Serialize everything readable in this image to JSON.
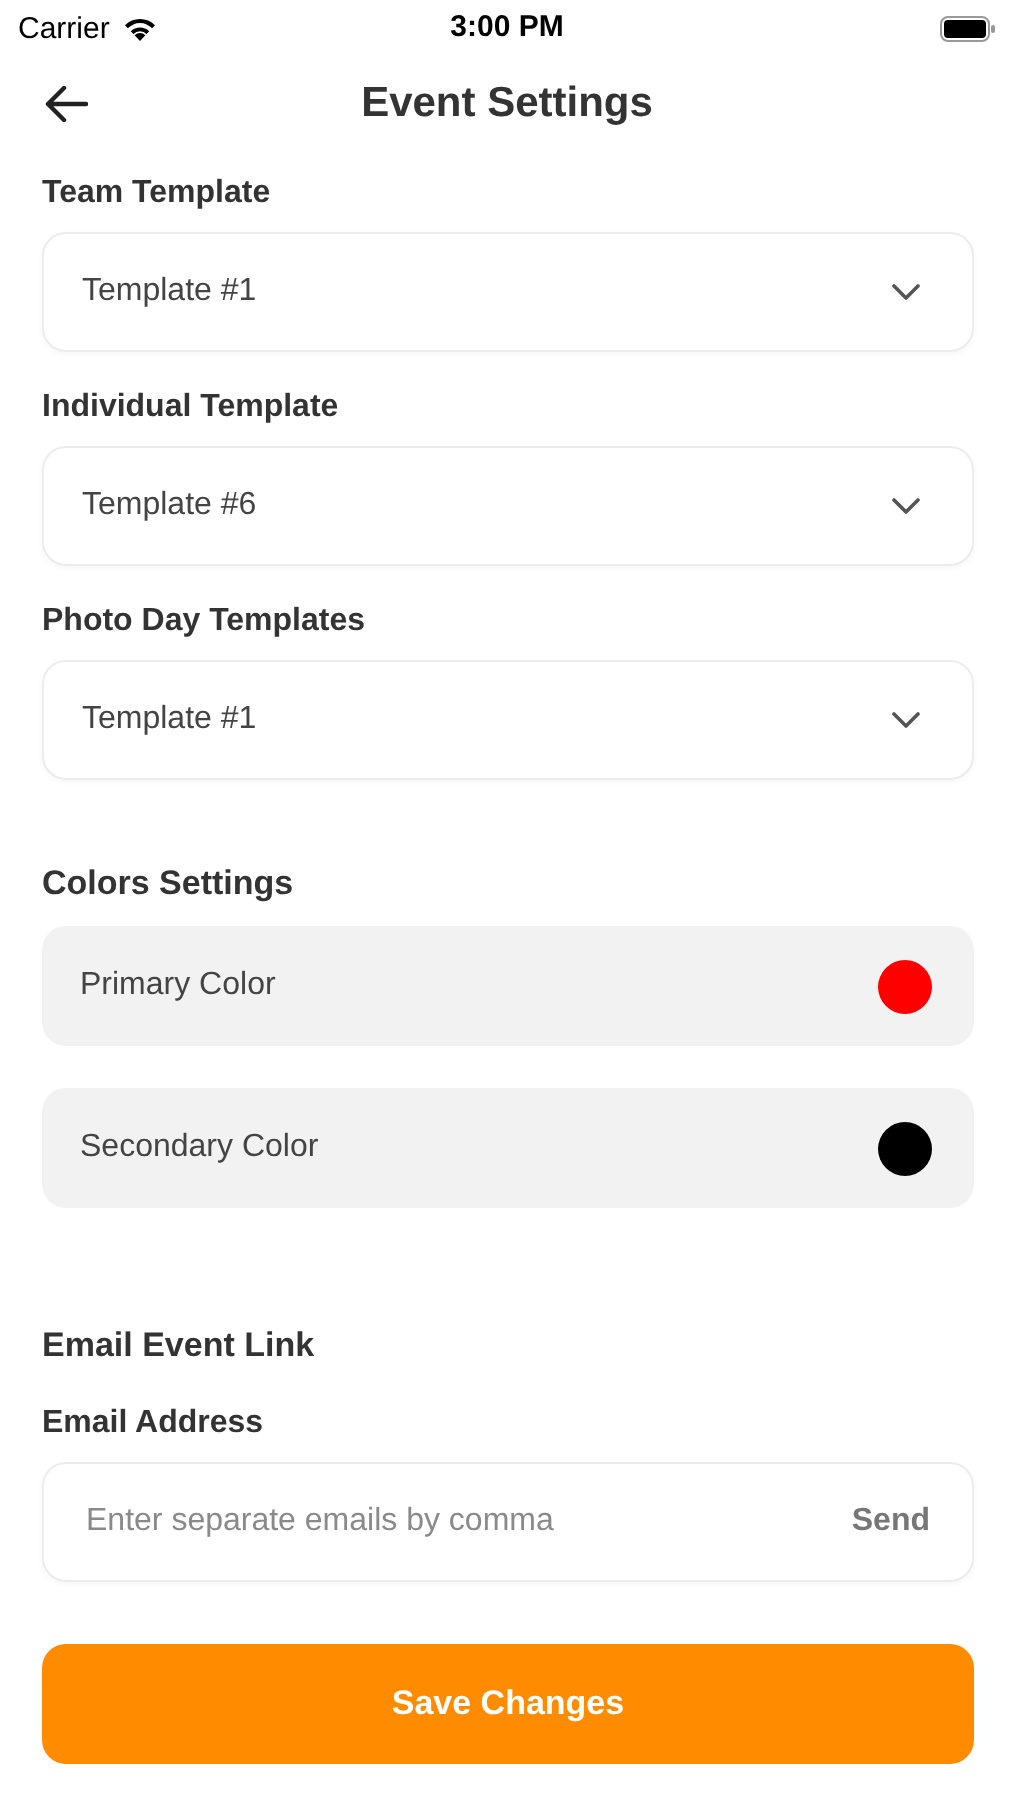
{
  "status_bar": {
    "carrier": "Carrier",
    "time": "3:00 PM"
  },
  "header": {
    "title": "Event Settings"
  },
  "templates": [
    {
      "label": "Team Template",
      "value": "Template #1"
    },
    {
      "label": "Individual Template",
      "value": "Template #6"
    },
    {
      "label": "Photo Day Templates",
      "value": "Template #1"
    }
  ],
  "colors": {
    "heading": "Colors Settings",
    "items": [
      {
        "label": "Primary Color",
        "color": "#ff0000"
      },
      {
        "label": "Secondary Color",
        "color": "#000000"
      }
    ]
  },
  "email": {
    "heading": "Email Event Link",
    "label": "Email Address",
    "placeholder": "Enter separate emails by comma",
    "send": "Send"
  },
  "save_button": "Save Changes"
}
